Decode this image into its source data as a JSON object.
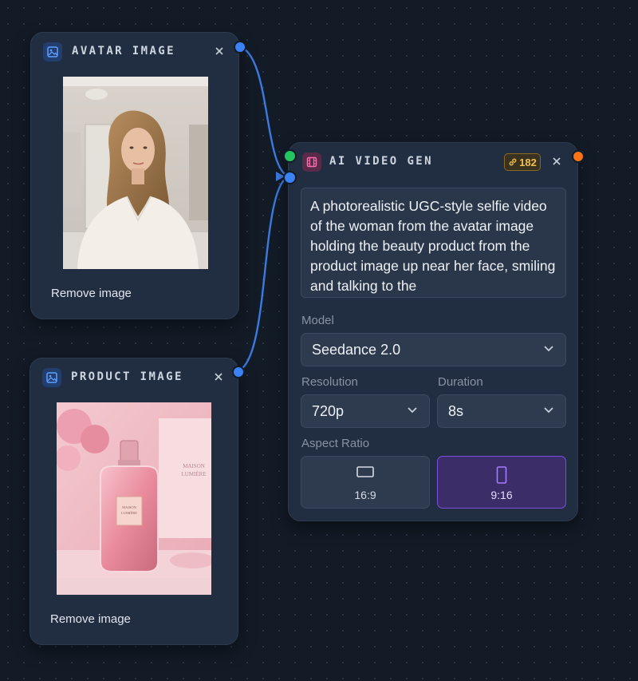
{
  "avatar_node": {
    "title": "AVATAR IMAGE",
    "remove_label": "Remove image",
    "icon": "image-icon",
    "close_icon": "close-icon"
  },
  "product_node": {
    "title": "PRODUCT IMAGE",
    "remove_label": "Remove image",
    "icon": "image-icon",
    "close_icon": "close-icon",
    "box_text": [
      "MAISON",
      "LUMIÈRE"
    ],
    "bottle_label": [
      "MAISON",
      "LUMIÈRE"
    ]
  },
  "video_node": {
    "title": "AI VIDEO GEN",
    "icon": "film-icon",
    "badge": {
      "icon": "link-icon",
      "count": "182"
    },
    "close_icon": "close-icon",
    "prompt_text": "A photorealistic UGC-style selfie video of the woman from the avatar image holding the beauty product from the product image up near her face, smiling and talking to the",
    "model": {
      "label": "Model",
      "value": "Seedance 2.0"
    },
    "resolution": {
      "label": "Resolution",
      "value": "720p"
    },
    "duration": {
      "label": "Duration",
      "value": "8s"
    },
    "aspect_ratio": {
      "label": "Aspect Ratio",
      "options": [
        {
          "label": "16:9",
          "icon": "landscape-icon",
          "selected": false
        },
        {
          "label": "9:16",
          "icon": "portrait-icon",
          "selected": true
        }
      ]
    }
  },
  "colors": {
    "canvas": "#131b27",
    "node_bg": "#212d40",
    "edge": "#3b7be0",
    "port_blue": "#3b82f6",
    "port_green": "#22c55e",
    "port_orange": "#f97316",
    "accent_purple": "#7c4ee0",
    "badge_gold": "#f0c04a"
  }
}
